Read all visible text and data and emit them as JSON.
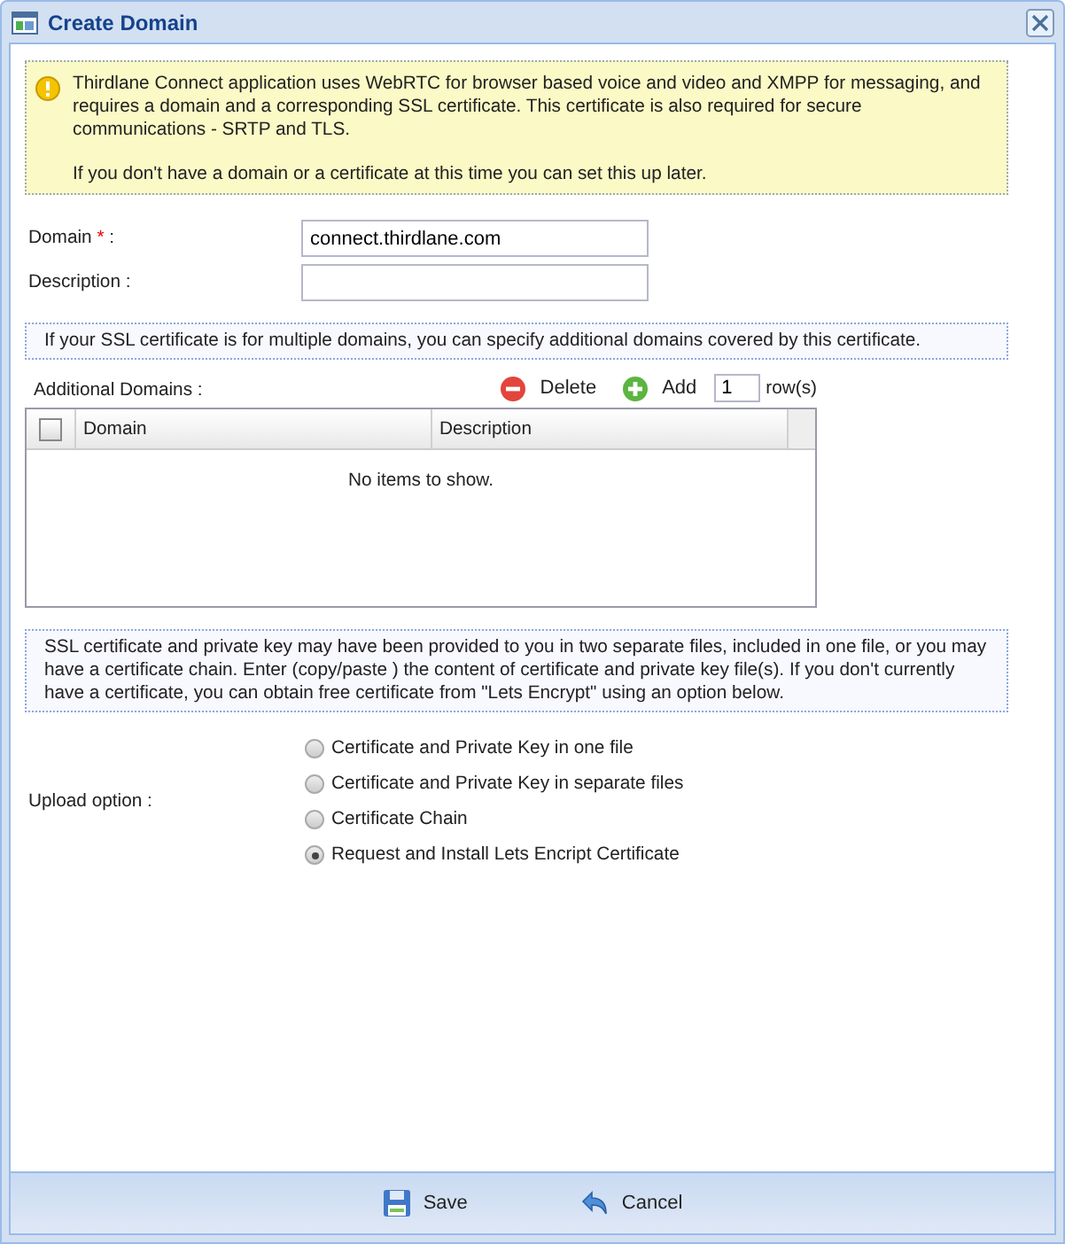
{
  "window": {
    "title": "Create Domain"
  },
  "notice": {
    "paragraphs": [
      "Thirdlane Connect application uses WebRTC for browser based voice and video and XMPP for messaging, and requires a domain and a corresponding SSL certificate. This certificate is also required for secure communications - SRTP and TLS.",
      "If you don't have a domain or a certificate at this time you can set this up later."
    ]
  },
  "fields": [
    {
      "label": "Domain",
      "required_mark": "*",
      "colon": ":",
      "value": "connect.thirdlane.com"
    },
    {
      "label": "Description",
      "colon": ":"
    }
  ],
  "domains_note": "If your SSL certificate is for multiple domains, you can specify additional domains covered by this certificate.",
  "additional_domains": {
    "label": "Additional Domains :",
    "delete": "Delete",
    "add": "Add",
    "count": "1",
    "count_suffix": "row(s)",
    "grid": {
      "select_all_checked": false,
      "columns": [
        "Domain",
        "Description"
      ],
      "empty_text": "No items to show."
    }
  },
  "upload_note": "SSL certificate and private key may have been provided to you in two separate files, included in one file, or you may have a certificate chain. Enter (copy/paste ) the content of certificate and private key file(s). If you don't currently have a certificate, you can obtain free certificate from \"Lets Encrypt\" using an option below.",
  "upload": {
    "label": "Upload option  :",
    "options": [
      {
        "label": "Certificate and Private Key in one file",
        "selected": false
      },
      {
        "label": "Certificate and Private Key in separate files",
        "selected": false
      },
      {
        "label": "Certificate Chain",
        "selected": false
      },
      {
        "label": "Request and Install Lets Encript Certificate",
        "selected": true
      }
    ]
  },
  "buttons": [
    {
      "kind": "save",
      "label": "Save"
    },
    {
      "kind": "cancel",
      "label": "Cancel"
    }
  ]
}
